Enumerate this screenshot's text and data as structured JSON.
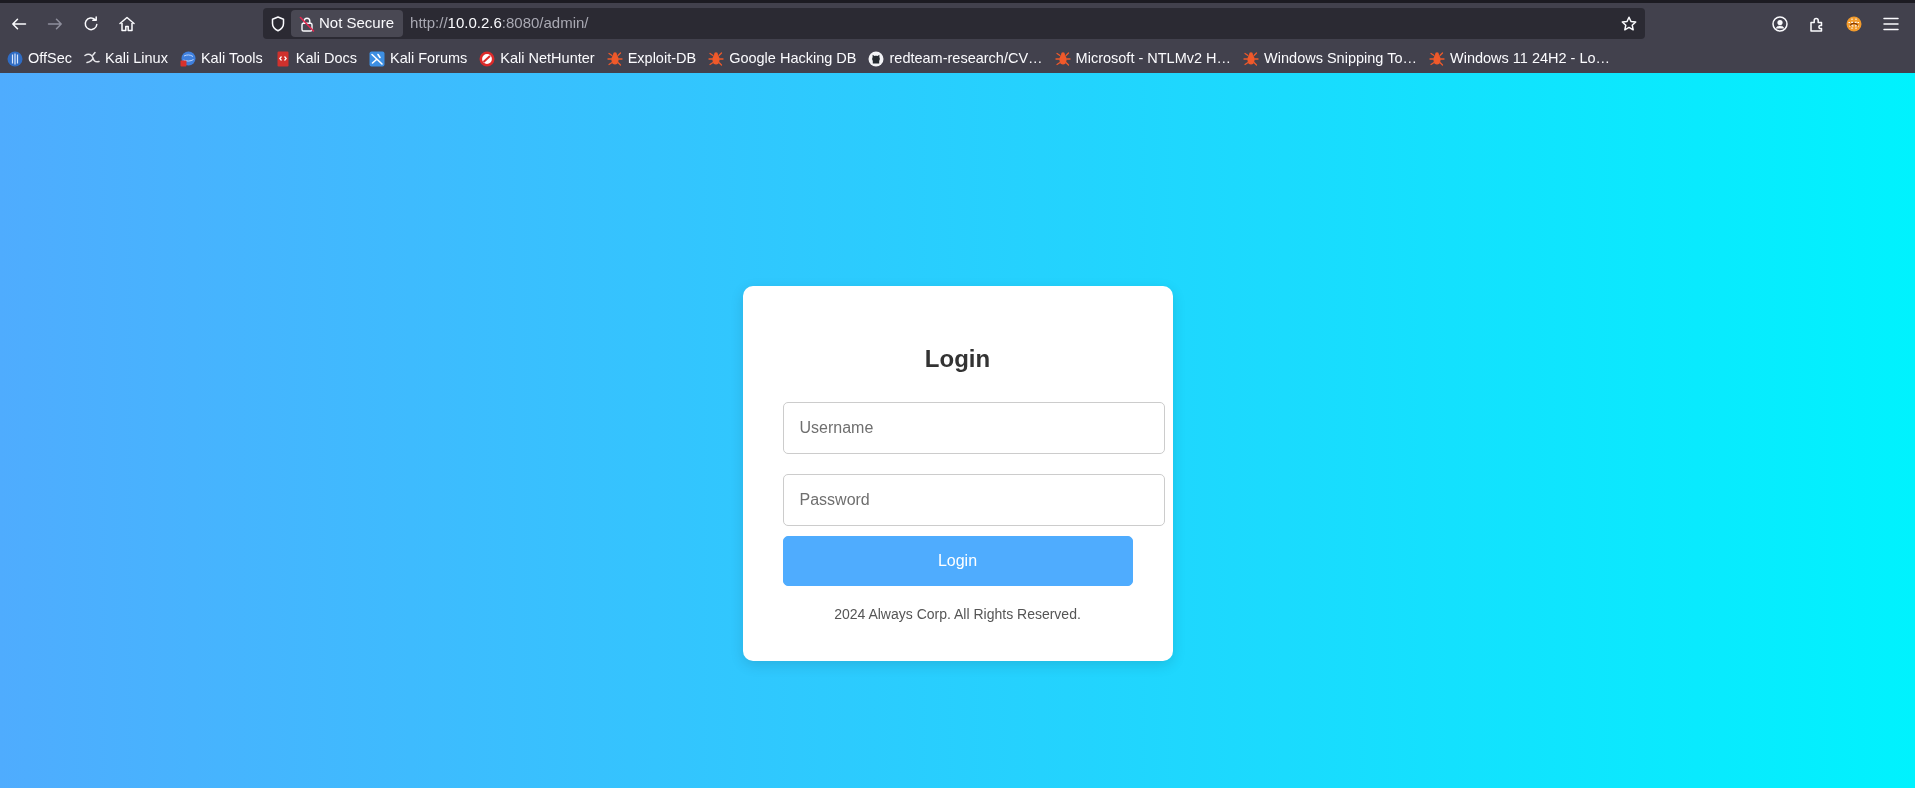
{
  "toolbar": {
    "navigation": [
      {
        "kind": "back",
        "disabled": false
      },
      {
        "kind": "forward",
        "disabled": true
      },
      {
        "kind": "reload",
        "disabled": false
      },
      {
        "kind": "home",
        "disabled": false
      }
    ],
    "security_label": "Not Secure",
    "url": {
      "scheme": "http://",
      "host": "10.0.2.6",
      "path": ":8080/admin/"
    }
  },
  "bookmarks": [
    {
      "label": "OffSec",
      "kind": "orb"
    },
    {
      "label": "Kali Linux",
      "kind": "dragon"
    },
    {
      "label": "Kali Tools",
      "kind": "ball"
    },
    {
      "label": "Kali Docs",
      "kind": "book"
    },
    {
      "label": "Kali Forums",
      "kind": "tile"
    },
    {
      "label": "Kali NetHunter",
      "kind": "ring"
    },
    {
      "label": "Exploit-DB",
      "kind": "bug"
    },
    {
      "label": "Google Hacking DB",
      "kind": "bug"
    },
    {
      "label": "redteam-research/CV…",
      "kind": "cat"
    },
    {
      "label": "Microsoft - NTLMv2 H…",
      "kind": "bug"
    },
    {
      "label": "Windows Snipping To…",
      "kind": "bug"
    },
    {
      "label": "Windows 11 24H2 - Lo…",
      "kind": "bug"
    }
  ],
  "login": {
    "title": "Login",
    "fields": [
      {
        "placeholder": "Username"
      },
      {
        "placeholder": "Password"
      }
    ],
    "button": "Login",
    "footer": "2024 Always Corp. All Rights Reserved."
  }
}
